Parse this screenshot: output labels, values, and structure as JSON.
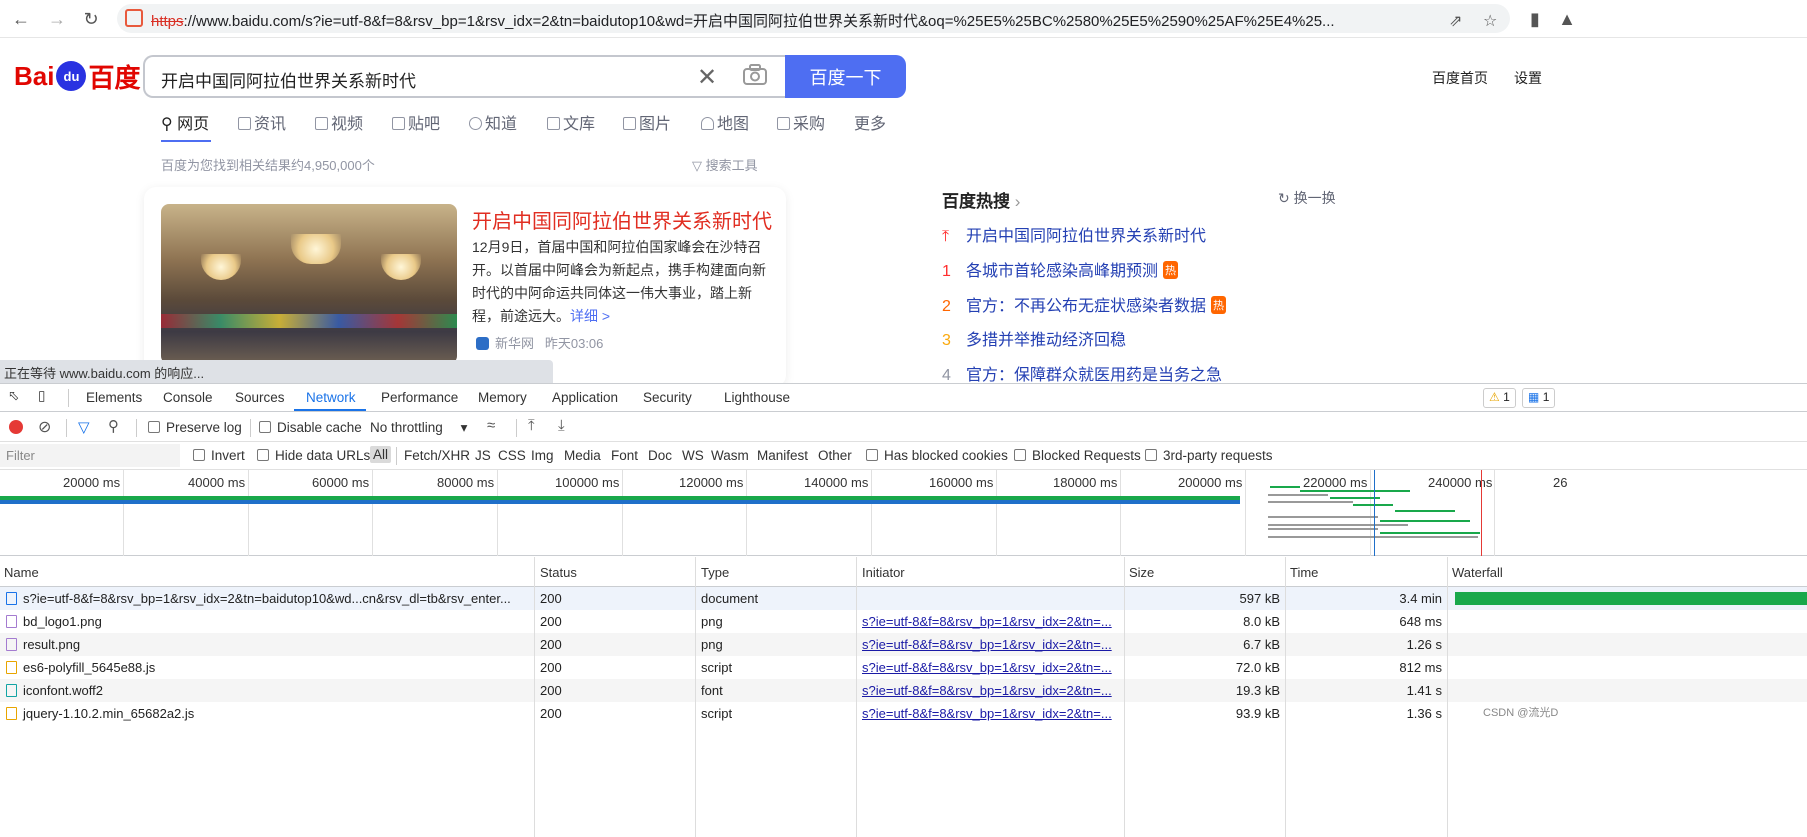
{
  "browser": {
    "url_scheme": "https",
    "url_rest": "://www.baidu.com/s?ie=utf-8&f=8&rsv_bp=1&rsv_idx=2&tn=baidutop10&wd=开启中国同阿拉伯世界关系新时代&oq=%25E5%25BC%2580%25E5%2590%25AF%25E4%25..."
  },
  "baidu": {
    "logo_left": "Bai",
    "logo_paw": "du",
    "logo_right": "百度",
    "search_value": "开启中国同阿拉伯世界关系新时代",
    "search_button": "百度一下",
    "home_link": "百度首页",
    "settings_link": "设置",
    "tabs": [
      "网页",
      "资讯",
      "视频",
      "贴吧",
      "知道",
      "文库",
      "图片",
      "地图",
      "采购",
      "更多"
    ],
    "result_count": "百度为您找到相关结果约4,950,000个",
    "search_tools": "搜索工具",
    "card": {
      "title": "开启中国同阿拉伯世界关系新时代",
      "desc": "12月9日，首届中国和阿拉伯国家峰会在沙特召开。以首届中阿峰会为新起点，携手构建面向新时代的中阿命运共同体这一伟大事业，踏上新程，前途远大。",
      "more": "详细 >",
      "source": "新华网",
      "time": "昨天03:06"
    },
    "hot": {
      "title": "百度热搜",
      "swap": "换一换",
      "items": [
        {
          "rank": "",
          "text": "开启中国同阿拉伯世界关系新时代",
          "badge": ""
        },
        {
          "rank": "1",
          "text": "各城市首轮感染高峰期预测",
          "badge": "热"
        },
        {
          "rank": "2",
          "text": "官方：不再公布无症状感染者数据",
          "badge": "热"
        },
        {
          "rank": "3",
          "text": "多措并举推动经济回稳",
          "badge": ""
        },
        {
          "rank": "4",
          "text": "官方：保障群众就医用药是当务之急",
          "badge": ""
        }
      ]
    }
  },
  "status_text": "正在等待 www.baidu.com 的响应...",
  "devtools": {
    "tabs": [
      "Elements",
      "Console",
      "Sources",
      "Network",
      "Performance",
      "Memory",
      "Application",
      "Security",
      "Lighthouse"
    ],
    "warnings": "1",
    "messages": "1",
    "toolbar": {
      "preserve_log": "Preserve log",
      "disable_cache": "Disable cache",
      "throttling": "No throttling"
    },
    "filter": {
      "placeholder": "Filter",
      "invert": "Invert",
      "hide_data_urls": "Hide data URLs",
      "types": [
        "All",
        "Fetch/XHR",
        "JS",
        "CSS",
        "Img",
        "Media",
        "Font",
        "Doc",
        "WS",
        "Wasm",
        "Manifest",
        "Other"
      ],
      "has_blocked_cookies": "Has blocked cookies",
      "blocked_requests": "Blocked Requests",
      "third_party": "3rd-party requests"
    },
    "timeline_ticks": [
      "20000 ms",
      "40000 ms",
      "60000 ms",
      "80000 ms",
      "100000 ms",
      "120000 ms",
      "140000 ms",
      "160000 ms",
      "180000 ms",
      "200000 ms",
      "220000 ms",
      "240000 ms",
      "26"
    ],
    "columns": [
      "Name",
      "Status",
      "Type",
      "Initiator",
      "Size",
      "Time",
      "Waterfall"
    ],
    "rows": [
      {
        "name": "s?ie=utf-8&f=8&rsv_bp=1&rsv_idx=2&tn=baidutop10&wd...cn&rsv_dl=tb&rsv_enter...",
        "status": "200",
        "type": "document",
        "initiator": "",
        "size": "597 kB",
        "time": "3.4 min",
        "icon": "doc-icon"
      },
      {
        "name": "bd_logo1.png",
        "status": "200",
        "type": "png",
        "initiator": "s?ie=utf-8&f=8&rsv_bp=1&rsv_idx=2&tn=...",
        "size": "8.0 kB",
        "time": "648 ms",
        "icon": "image-icon"
      },
      {
        "name": "result.png",
        "status": "200",
        "type": "png",
        "initiator": "s?ie=utf-8&f=8&rsv_bp=1&rsv_idx=2&tn=...",
        "size": "6.7 kB",
        "time": "1.26 s",
        "icon": "image-icon"
      },
      {
        "name": "es6-polyfill_5645e88.js",
        "status": "200",
        "type": "script",
        "initiator": "s?ie=utf-8&f=8&rsv_bp=1&rsv_idx=2&tn=...",
        "size": "72.0 kB",
        "time": "812 ms",
        "icon": "script-icon"
      },
      {
        "name": "iconfont.woff2",
        "status": "200",
        "type": "font",
        "initiator": "s?ie=utf-8&f=8&rsv_bp=1&rsv_idx=2&tn=...",
        "size": "19.3 kB",
        "time": "1.41 s",
        "icon": "font-icon"
      },
      {
        "name": "jquery-1.10.2.min_65682a2.js",
        "status": "200",
        "type": "script",
        "initiator": "s?ie=utf-8&f=8&rsv_bp=1&rsv_idx=2&tn=...",
        "size": "93.9 kB",
        "time": "1.36 s",
        "icon": "script-icon"
      }
    ]
  },
  "watermark": "CSDN @流光D",
  "colors": {
    "baidu_blue": "#4e6ef2",
    "baidu_red": "#e10601",
    "link_blue": "#2440b3",
    "devtools_accent": "#1a73e8"
  }
}
